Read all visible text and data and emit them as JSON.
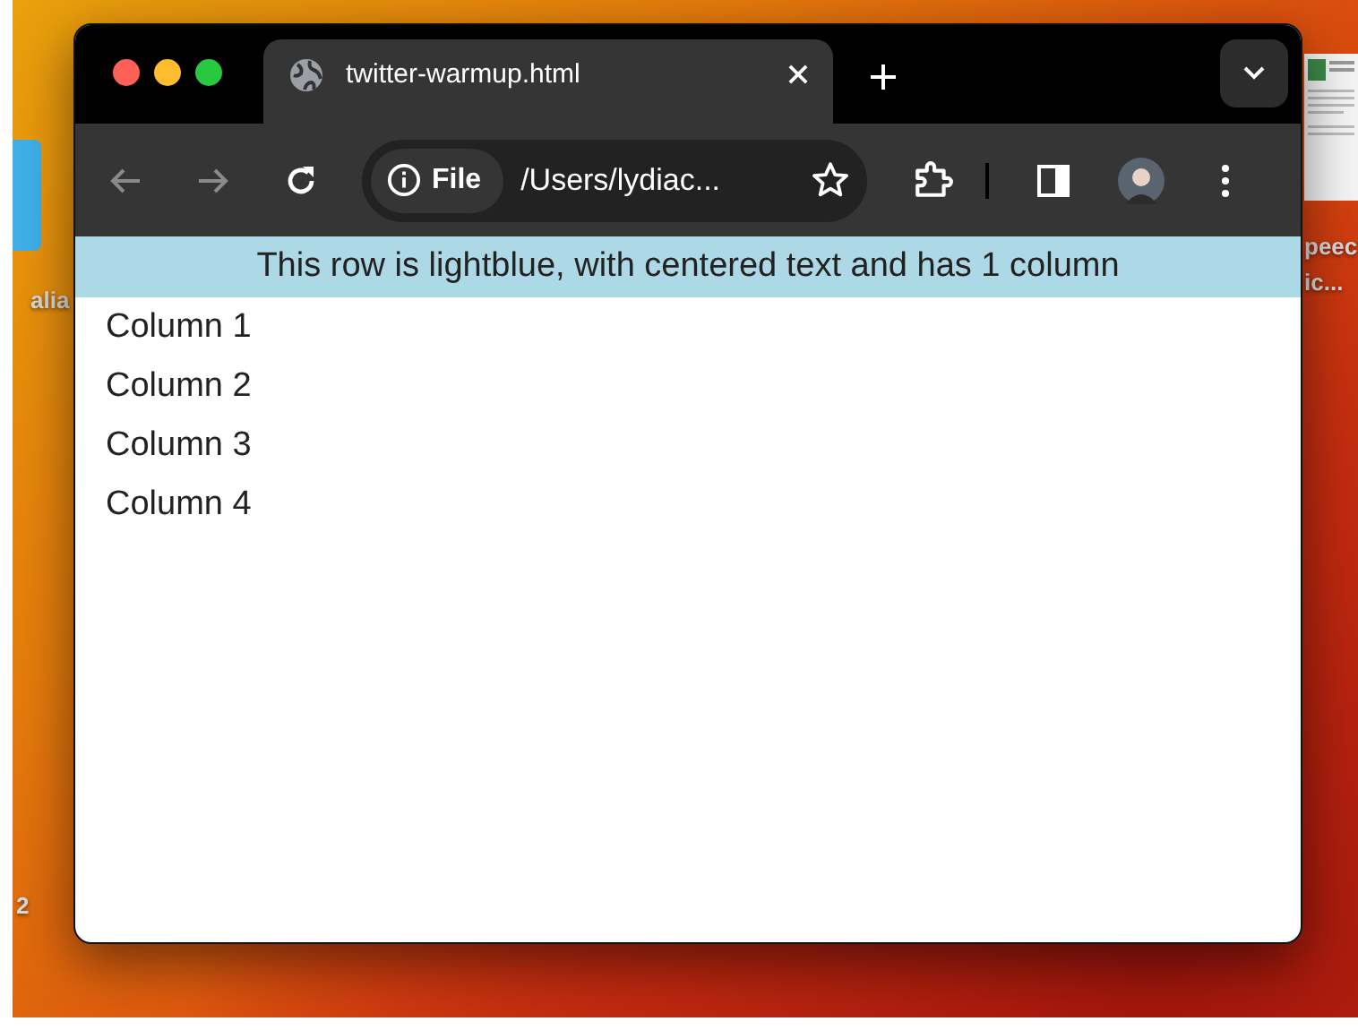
{
  "desktop": {
    "labels": [
      "alia",
      "peec",
      "ic...",
      "2"
    ]
  },
  "tabs": [
    {
      "title": "twitter-warmup.html",
      "selected": true
    }
  ],
  "toolbar": {
    "nav": [
      {
        "kind": "back",
        "disabled": true
      },
      {
        "kind": "forward",
        "disabled": true
      },
      {
        "kind": "reload",
        "disabled": false
      }
    ],
    "security_chip": "File",
    "address": "/Users/lydiac..."
  },
  "page": {
    "header_row": "This row is lightblue, with centered text and has 1 column",
    "rows": [
      "Column 1",
      "Column 2",
      "Column 3",
      "Column 4"
    ]
  }
}
